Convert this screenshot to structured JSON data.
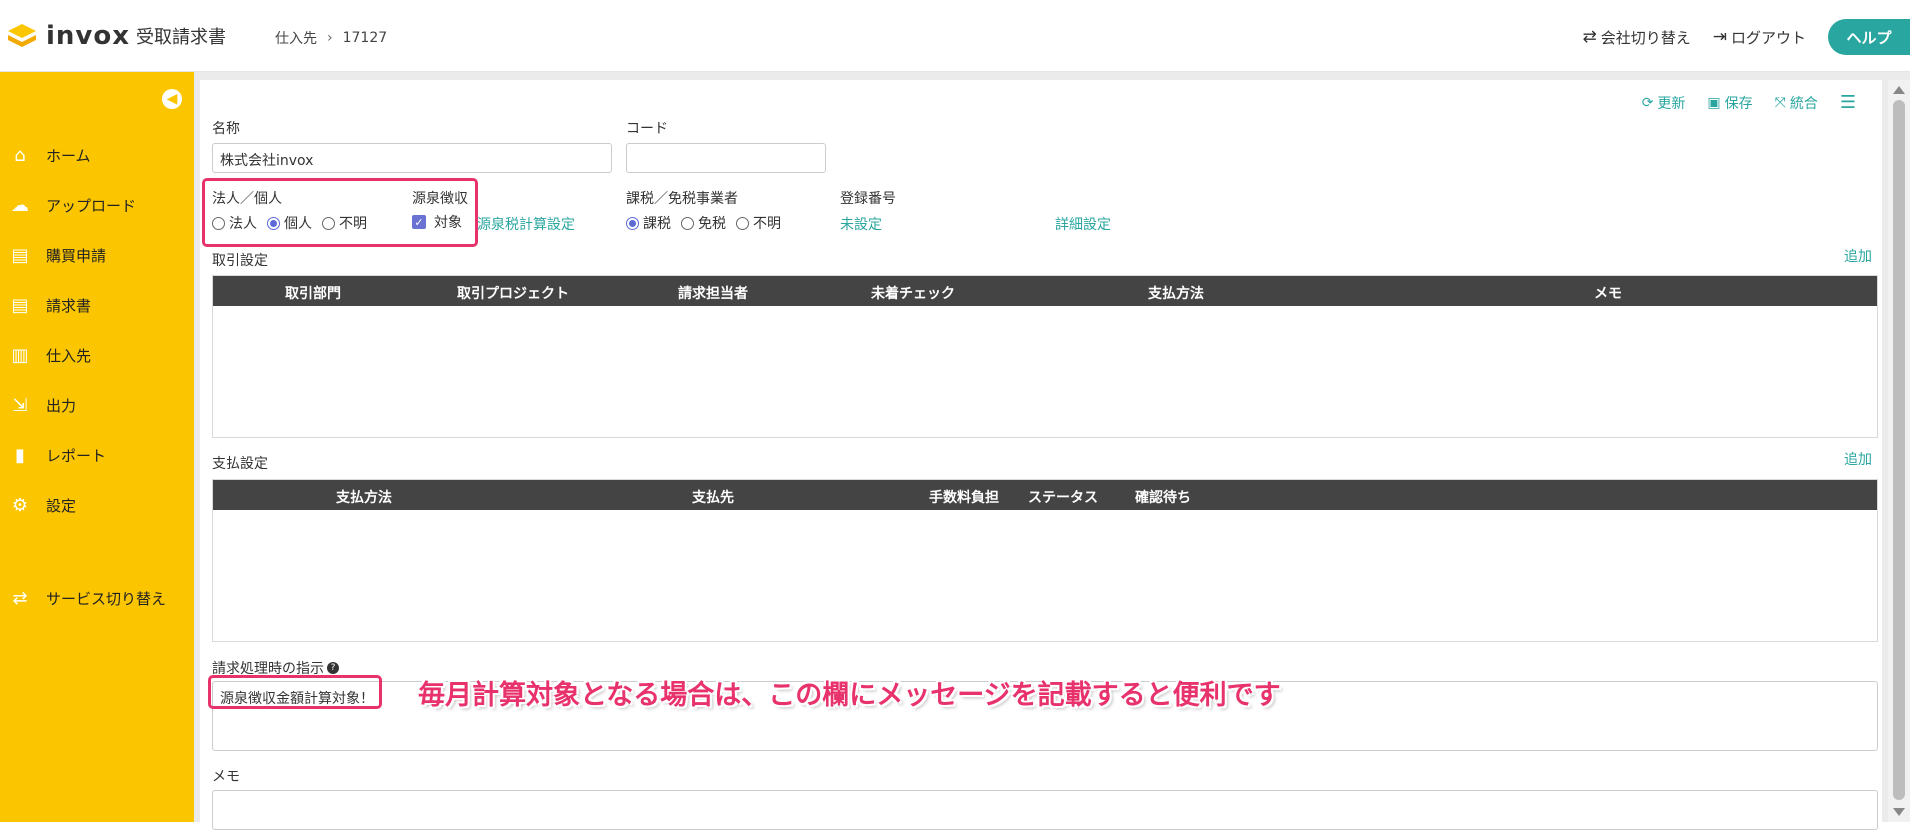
{
  "header": {
    "logo_text": "invox",
    "logo_sub": "受取請求書",
    "breadcrumb_parent": "仕入先",
    "breadcrumb_current": "17127",
    "switch_company": "会社切り替え",
    "logout": "ログアウト",
    "help": "ヘルプ"
  },
  "sidebar": {
    "items": [
      {
        "label": "ホーム",
        "icon": "home-icon"
      },
      {
        "label": "アップロード",
        "icon": "upload-icon"
      },
      {
        "label": "購買申請",
        "icon": "document-icon"
      },
      {
        "label": "請求書",
        "icon": "document-icon"
      },
      {
        "label": "仕入先",
        "icon": "building-icon"
      },
      {
        "label": "出力",
        "icon": "export-icon"
      },
      {
        "label": "レポート",
        "icon": "chart-icon"
      },
      {
        "label": "設定",
        "icon": "gear-icon"
      }
    ],
    "service_switch": "サービス切り替え"
  },
  "toolbar": {
    "refresh": "更新",
    "save": "保存",
    "merge": "統合"
  },
  "form": {
    "name_label": "名称",
    "name_value": "株式会社invox",
    "code_label": "コード",
    "code_value": "",
    "entity_label": "法人／個人",
    "entity_options": [
      "法人",
      "個人",
      "不明"
    ],
    "entity_selected": "個人",
    "withholding_label": "源泉徴収",
    "withholding_check_label": "対象",
    "withholding_link": "源泉税計算設定",
    "tax_label": "課税／免税事業者",
    "tax_options": [
      "課税",
      "免税",
      "不明"
    ],
    "tax_selected": "課税",
    "reg_label": "登録番号",
    "reg_value": "未設定",
    "detail_link": "詳細設定"
  },
  "trade": {
    "title": "取引設定",
    "add": "追加",
    "columns": [
      "取引部門",
      "取引プロジェクト",
      "請求担当者",
      "未着チェック",
      "支払方法",
      "メモ"
    ]
  },
  "payment": {
    "title": "支払設定",
    "add": "追加",
    "columns": [
      "支払方法",
      "支払先",
      "手数料負担",
      "ステータス",
      "確認待ち"
    ]
  },
  "instruction": {
    "label": "請求処理時の指示",
    "value": "源泉徴収金額計算対象！"
  },
  "memo": {
    "label": "メモ"
  },
  "annotation": "毎月計算対象となる場合は、この欄にメッセージを記載すると便利です",
  "colors": {
    "sidebar": "#fbc600",
    "accent": "#2aa6a0",
    "highlight": "#e8326c",
    "table_header": "#444444"
  }
}
